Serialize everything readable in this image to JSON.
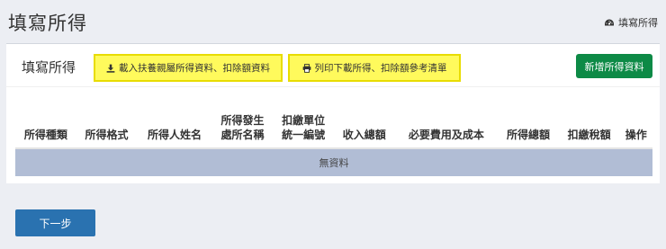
{
  "header": {
    "title": "填寫所得",
    "breadcrumb": {
      "icon": "dashboard-icon",
      "label": "填寫所得"
    }
  },
  "panel": {
    "title": "填寫所得",
    "import_button": {
      "icon": "download-icon",
      "label": "載入扶養親屬所得資料、扣除額資料"
    },
    "print_button": {
      "icon": "print-icon",
      "label": "列印下載所得、扣除額參考清單"
    },
    "add_button": {
      "label": "新增所得資料"
    }
  },
  "table": {
    "columns": [
      "所得種類",
      "所得格式",
      "所得人姓名",
      [
        "所得發生",
        "處所名稱"
      ],
      [
        "扣繳單位",
        "統一編號"
      ],
      "收入總額",
      "必要費用及成本",
      "所得總額",
      "扣繳稅額",
      "操作"
    ],
    "empty_text": "無資料"
  },
  "footer": {
    "next_button": "下一步"
  },
  "colors": {
    "highlight": "#fffa5c",
    "add_button": "#0d8a46",
    "next_button": "#2a72b0",
    "empty_row": "#b1bdd5"
  }
}
